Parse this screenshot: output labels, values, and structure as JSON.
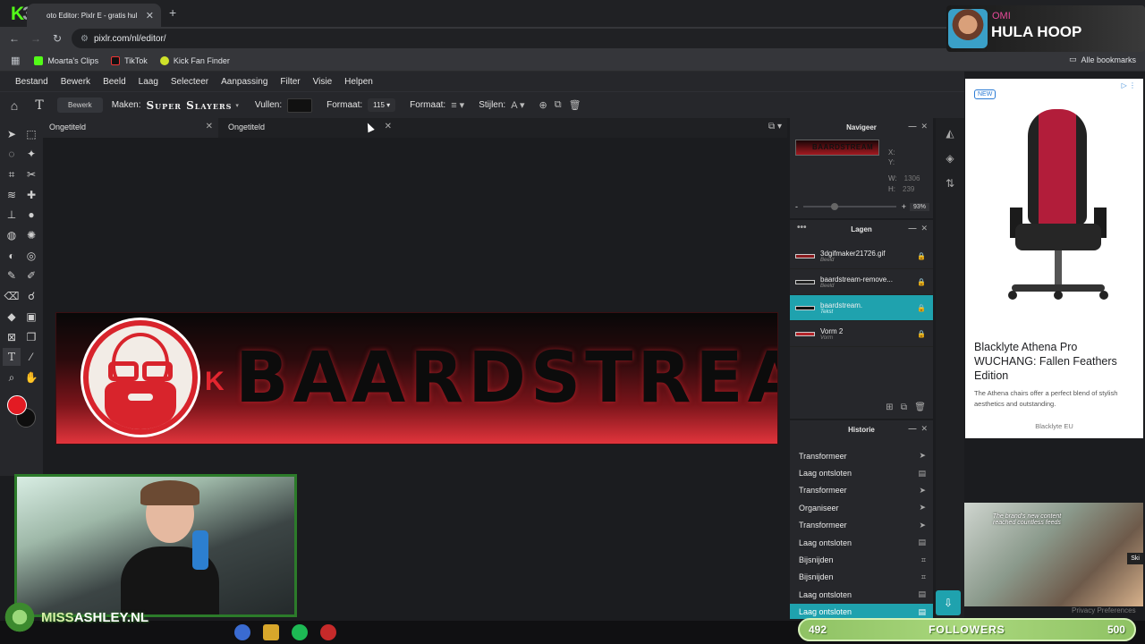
{
  "browser": {
    "tab_title": "oto Editor: Pixlr E - gratis hul",
    "url": "pixlr.com/nl/editor/",
    "bookmarks": [
      "Moarta's Clips",
      "TikTok",
      "Kick Fan Finder"
    ],
    "all_bookmarks": "Alle bookmarks"
  },
  "now_playing": {
    "artist": "OMI",
    "song": "HULA HOOP"
  },
  "menu": [
    "Bestand",
    "Bewerk",
    "Beeld",
    "Laag",
    "Selecteer",
    "Aanpassing",
    "Filter",
    "Visie",
    "Helpen"
  ],
  "toolbar": {
    "edit_button": "Bewerk",
    "make_label": "Maken:",
    "font": "Super Slayers",
    "fill_label": "Vullen:",
    "fill_color": "#111111",
    "size_label": "Formaat:",
    "size_value": "115",
    "align_label": "Formaat:",
    "style_label": "Stijlen:"
  },
  "documents": [
    {
      "title": "Ongetiteld",
      "active": true
    },
    {
      "title": "Ongetiteld",
      "active": false
    }
  ],
  "canvas": {
    "kick_mark": "K",
    "banner_text": "BAARDSTREAM"
  },
  "navigator": {
    "title": "Navigeer",
    "thumb_text": "BAARDSTREAM",
    "x_label": "X:",
    "x_value": "",
    "y_label": "Y:",
    "y_value": "",
    "w_label": "W:",
    "w_value": "1306",
    "h_label": "H:",
    "h_value": "239",
    "zoom_minus": "-",
    "zoom_plus": "+",
    "zoom": "93%",
    "zoom_fraction": 0.3
  },
  "layers": {
    "title": "Lagen",
    "items": [
      {
        "name": "3dgifmaker21726.gif",
        "type": "Beeld",
        "active": false
      },
      {
        "name": "baardstream-remove...",
        "type": "Beeld",
        "active": false
      },
      {
        "name": "baardstream.",
        "type": "Tekst",
        "active": true
      },
      {
        "name": "Vorm 2",
        "type": "Vorm",
        "active": false
      }
    ]
  },
  "history": {
    "title": "Historie",
    "items": [
      {
        "label": "Transformeer",
        "icon": "pointer-icon"
      },
      {
        "label": "Laag ontsloten",
        "icon": "layer-icon"
      },
      {
        "label": "Transformeer",
        "icon": "pointer-icon"
      },
      {
        "label": "Organiseer",
        "icon": "pointer-icon"
      },
      {
        "label": "Transformeer",
        "icon": "pointer-icon"
      },
      {
        "label": "Laag ontsloten",
        "icon": "layer-icon"
      },
      {
        "label": "Bijsnijden",
        "icon": "crop-icon"
      },
      {
        "label": "Bijsnijden",
        "icon": "crop-icon"
      },
      {
        "label": "Laag ontsloten",
        "icon": "layer-icon"
      },
      {
        "label": "Laag ontsloten",
        "icon": "layer-icon",
        "active": true
      }
    ]
  },
  "ad": {
    "badge": "NEW",
    "title": "Blacklyte Athena Pro WUCHANG: Fallen Feathers Edition",
    "body": "The Athena chairs offer a perfect blend of stylish aesthetics and outstanding.",
    "brand": "Blacklyte EU",
    "video_caption": "The brand's new content reached countless feeds",
    "skip": "Ski",
    "privacy": "Privacy Preferences"
  },
  "stream": {
    "name_prefix": "MISS",
    "name_suffix": "ASHLEY.NL",
    "followers_current": "492",
    "followers_label": "FOLLOWERS",
    "followers_goal": "500"
  },
  "colors": {
    "accent": "#1fa2ae",
    "foreground": "#e31b23",
    "background": "#0e0e0e",
    "kick": "#53fc18"
  }
}
